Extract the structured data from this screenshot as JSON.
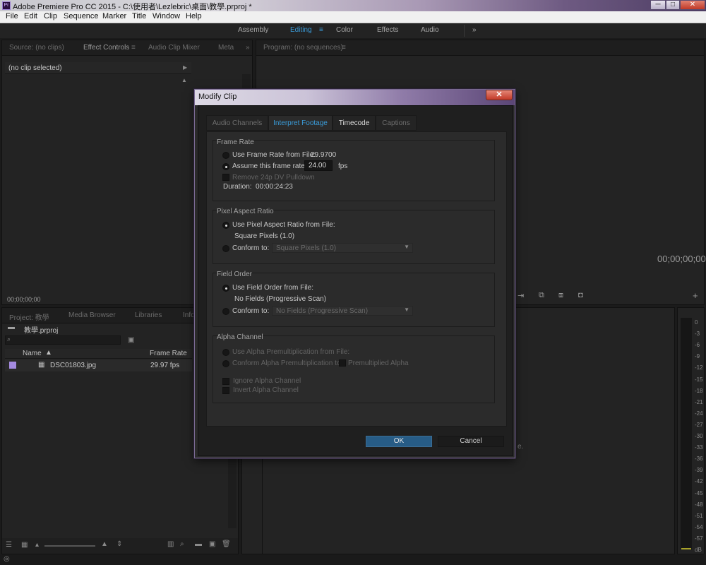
{
  "window": {
    "title": "Adobe Premiere Pro CC 2015 - C:\\使用者\\Lezlebric\\桌面\\教學.prproj *",
    "app_icon": "Pr",
    "minimize": "─",
    "maximize": "□",
    "close": "✕"
  },
  "menu": [
    "File",
    "Edit",
    "Clip",
    "Sequence",
    "Marker",
    "Title",
    "Window",
    "Help"
  ],
  "workspaces": {
    "items": [
      "Assembly",
      "Editing",
      "Color",
      "Effects",
      "Audio"
    ],
    "active": "Editing",
    "menu_icon": "≡",
    "overflow": "»"
  },
  "source_panel": {
    "tabs": [
      "Source: (no clips)",
      "Effect Controls",
      "Audio Clip Mixer",
      "Meta"
    ],
    "active_tab": "Effect Controls",
    "tab_menu": "≡",
    "overflow": "»",
    "no_clip": "(no clip selected)",
    "timecode": "00;00;00;00"
  },
  "program_panel": {
    "title": "Program: (no sequences)",
    "tab_menu": "≡",
    "timecode": "00;00;00;00"
  },
  "project_panel": {
    "tabs": [
      "Project: 教學",
      "Media Browser",
      "Libraries",
      "Info"
    ],
    "project_file": "教學.prproj",
    "columns": [
      "Name",
      "Frame Rate"
    ],
    "items": [
      {
        "name": "DSC01803.jpg",
        "frame_rate": "29.97 fps",
        "label_color": "#a48ae0"
      }
    ]
  },
  "timeline_panel": {
    "hint": "e."
  },
  "audio_meter": {
    "ticks": [
      "0",
      "-3",
      "-6",
      "-9",
      "-12",
      "-15",
      "-18",
      "-21",
      "-24",
      "-27",
      "-30",
      "-33",
      "-36",
      "-39",
      "-42",
      "-45",
      "-48",
      "-51",
      "-54",
      "-57",
      "dB"
    ]
  },
  "dialog": {
    "title": "Modify Clip",
    "close_icon": "✕",
    "tabs": [
      "Audio Channels",
      "Interpret Footage",
      "Timecode",
      "Captions"
    ],
    "active_tab": "Interpret Footage",
    "frame_rate": {
      "label": "Frame Rate",
      "use_from_file_label": "Use Frame Rate from File:",
      "file_rate": "29.9700",
      "assume_label": "Assume this frame rate:",
      "assume_value": "24.00",
      "unit": "fps",
      "pulldown_label": "Remove 24p DV Pulldown",
      "duration_label": "Duration:",
      "duration_value": "00:00:24:23"
    },
    "pixel_aspect": {
      "label": "Pixel Aspect Ratio",
      "use_from_file_label": "Use Pixel Aspect Ratio from File:",
      "file_value": "Square Pixels (1.0)",
      "conform_label": "Conform to:",
      "conform_value": "Square Pixels (1.0)"
    },
    "field_order": {
      "label": "Field Order",
      "use_from_file_label": "Use Field Order from File:",
      "file_value": "No Fields (Progressive Scan)",
      "conform_label": "Conform to:",
      "conform_value": "No Fields (Progressive Scan)"
    },
    "alpha": {
      "label": "Alpha Channel",
      "use_premult_label": "Use Alpha Premultiplication from File:",
      "conform_premult_label": "Conform Alpha Premultiplication to:",
      "premult_label": "Premultiplied Alpha",
      "ignore_label": "Ignore Alpha Channel",
      "invert_label": "Invert Alpha Channel"
    },
    "ok": "OK",
    "cancel": "Cancel"
  }
}
